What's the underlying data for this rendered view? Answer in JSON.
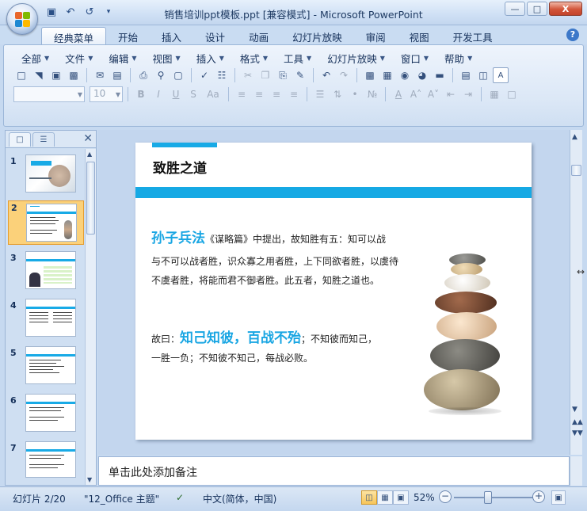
{
  "window": {
    "title": "销售培训ppt模板.ppt [兼容模式] - Microsoft PowerPoint",
    "controls": {
      "minimize": "—",
      "maximize": "□",
      "close": "X"
    }
  },
  "ribbon_tabs": [
    "经典菜单",
    "开始",
    "插入",
    "设计",
    "动画",
    "幻灯片放映",
    "审阅",
    "视图",
    "开发工具"
  ],
  "active_tab": "经典菜单",
  "menus": [
    "全部",
    "文件",
    "编辑",
    "视图",
    "插入",
    "格式",
    "工具",
    "幻灯片放映",
    "窗口",
    "帮助"
  ],
  "format_toolbar": {
    "font_name": "",
    "font_size": "10"
  },
  "slides_panel": {
    "thumbnails": [
      "1",
      "2",
      "3",
      "4",
      "5",
      "6",
      "7"
    ],
    "selected": "2"
  },
  "slide": {
    "title": "致胜之道",
    "para1_highlight": "孙子兵法",
    "para1_rest": "《谋略篇》中提出，故知胜有五：知可以战",
    "para1_line2": "与不可以战者胜，识众寡之用者胜，上下同欲者胜，以虞待",
    "para1_line3": "不虞者胜，将能而君不御者胜。此五者，知胜之道也。",
    "para2_prefix": "故曰：",
    "para2_highlight": "知己知彼，百战不殆",
    "para2_rest": "；不知彼而知己，",
    "para2_line2": "一胜一负；不知彼不知己，每战必败。"
  },
  "notes_placeholder": "单击此处添加备注",
  "status": {
    "slide_pos": "幻灯片 2/20",
    "theme": "\"12_Office 主题\"",
    "language": "中文(简体，中国)",
    "zoom": "52%",
    "zoom_fraction": 0.52
  },
  "colors": {
    "accent": "#18aae6",
    "highlight_text": "#19a6e3"
  }
}
